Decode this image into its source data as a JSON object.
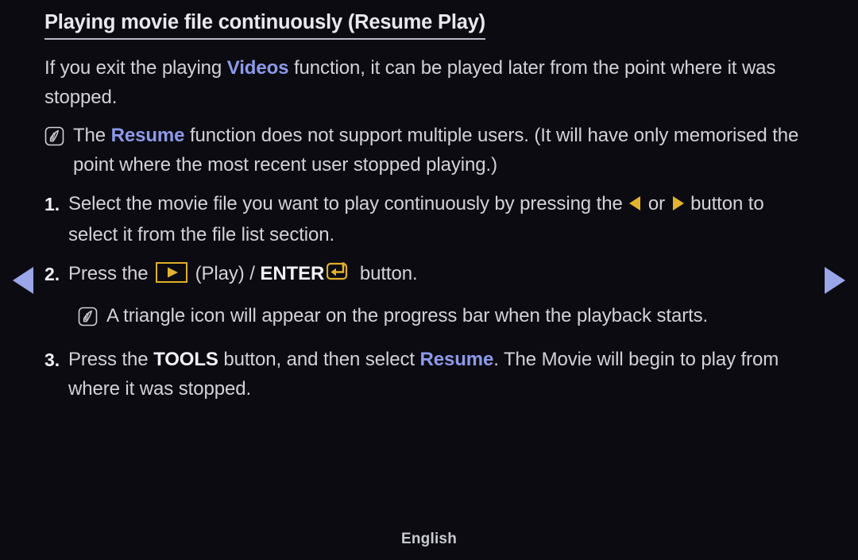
{
  "screen": {
    "background_color": "#0b0b11",
    "text_color": "#d2d2d8",
    "accent_blue": "#8c9aea",
    "accent_gold": "#e0ae28"
  },
  "page": {
    "title": "Playing movie file continuously (Resume Play)",
    "intro": {
      "part1": "If you exit the playing ",
      "highlight": "Videos",
      "part2": " function, it can be played later from the point where it was stopped."
    },
    "notes": [
      {
        "icon": "note-pen-icon",
        "part1": "The ",
        "highlight": "Resume",
        "part2": " function does not support multiple users. (It will have only memorised the point where the most recent user stopped playing.)"
      },
      {
        "icon": "note-pen-icon",
        "text": "A triangle icon will appear on the progress bar when the playback starts."
      }
    ],
    "steps": [
      {
        "number": "1.",
        "part1": "Select the movie file you want to play continuously by pressing the ",
        "icon_left": "left-triangle-icon",
        "mid": " or ",
        "icon_right": "right-triangle-icon",
        "part2": " button to select it from the file list section."
      },
      {
        "number": "2.",
        "part1": "Press the ",
        "icon_play": "play-button-icon",
        "mid1": " (Play) / ",
        "enter_label": "ENTER",
        "icon_enter": "enter-return-icon",
        "part2": " button."
      },
      {
        "number": "3.",
        "part1": "Press the ",
        "bold1": "TOOLS",
        "mid1": " button, and then select ",
        "highlight": "Resume",
        "part2": ". The Movie will begin to play from where it was stopped."
      }
    ]
  },
  "nav": {
    "prev_icon": "prev-page-arrow-icon",
    "next_icon": "next-page-arrow-icon"
  },
  "footer": {
    "language": "English"
  }
}
